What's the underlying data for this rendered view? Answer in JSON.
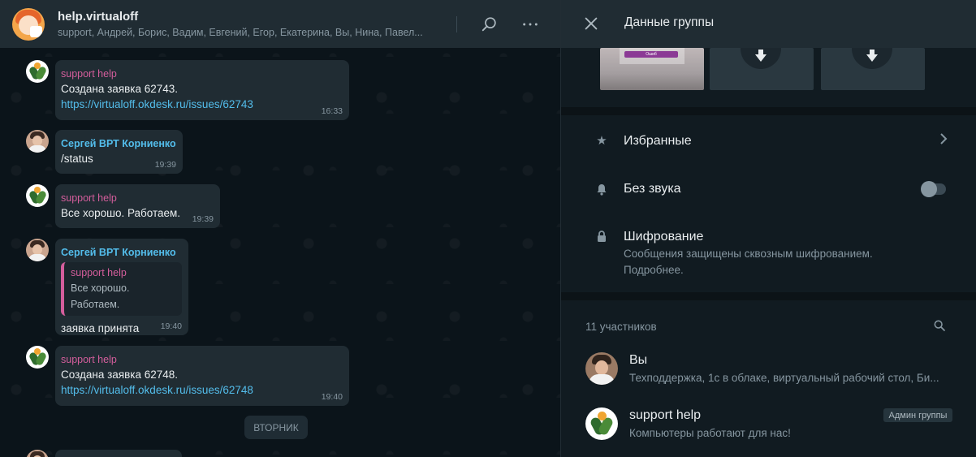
{
  "chat": {
    "title": "help.virtualoff",
    "subtitle": "support, Андрей, Борис, Вадим, Евгений, Егор, Екатерина, Вы, Нина, Павел..."
  },
  "messages": [
    {
      "sender": "support help",
      "lines": [
        "Создана заявка 62743."
      ],
      "link": "https://virtualoff.okdesk.ru/issues/62743",
      "time": "16:33"
    },
    {
      "sender": "Сергей ВРТ Корниенко",
      "lines": [
        "/status"
      ],
      "time": "19:39"
    },
    {
      "sender": "support help",
      "lines": [
        "Все хорошо. Работаем."
      ],
      "time": "19:39"
    },
    {
      "sender": "Сергей ВРТ Корниенко",
      "quote": {
        "sender": "support help",
        "text": "Все хорошо. Работаем."
      },
      "lines": [
        "заявка принята"
      ],
      "time": "19:40"
    },
    {
      "sender": "support help",
      "lines": [
        "Создана заявка 62748."
      ],
      "link": "https://virtualoff.okdesk.ru/issues/62748",
      "time": "19:40"
    }
  ],
  "day_separator": "ВТОРНИК",
  "info_panel": {
    "title": "Данные группы",
    "starred_label": "Избранные",
    "mute_label": "Без звука",
    "mute_enabled": false,
    "encryption_label": "Шифрование",
    "encryption_text_line1": "Сообщения защищены сквозным шифрованием.",
    "encryption_text_line2": "Подробнее.",
    "participants_count": "11 участников",
    "media_thumb_caption": "Ошиб",
    "members": [
      {
        "name": "Вы",
        "status": "Техподдержка, 1с в облаке, виртуальный рабочий стол, Би..."
      },
      {
        "name": "support help",
        "status": "Компьютеры работают для нас!",
        "badge": "Админ группы"
      }
    ]
  },
  "icons": {
    "search": "search-icon",
    "menu": "menu-dots-icon",
    "close": "close-icon",
    "star": "star-icon",
    "bell": "bell-icon",
    "lock": "lock-icon",
    "chevron": "chevron-right-icon",
    "download": "download-icon"
  },
  "colors": {
    "accent_link": "#53bdeb",
    "support_name": "#d45e9c",
    "panel_bg": "#111b21",
    "header_bg": "#202c33",
    "bubble_bg": "#202c33"
  }
}
